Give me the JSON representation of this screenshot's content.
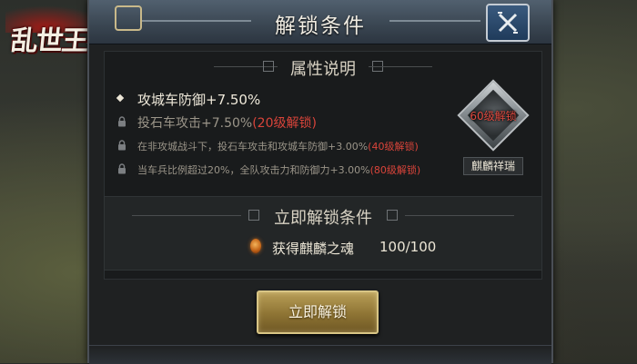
{
  "logo": {
    "text": "乱世王者"
  },
  "header": {
    "title": "解锁条件"
  },
  "attributes": {
    "section_title": "属性说明",
    "rows": [
      {
        "text": "攻城车防御+7.50%",
        "locked": false,
        "lock_note": ""
      },
      {
        "text": "投石车攻击+7.50%",
        "locked": true,
        "lock_note": "(20级解锁)"
      },
      {
        "text": "在非攻城战斗下，投石车攻击和攻城车防御+3.00%",
        "locked": true,
        "lock_note": "(40级解锁)"
      },
      {
        "text": "当车兵比例超过20%，全队攻击力和防御力+3.00%",
        "locked": true,
        "lock_note": "(80级解锁)"
      }
    ]
  },
  "badge": {
    "level_text": "60级解锁",
    "name": "麒麟祥瑞"
  },
  "unlock": {
    "section_title": "立即解锁条件",
    "item_name": "获得麒麟之魂",
    "item_count": "100/100",
    "button_label": "立即解锁"
  },
  "colors": {
    "accent_red": "#d9443a",
    "button_gold": "#b89e57",
    "header_blue": "#3b4753"
  },
  "icons": {
    "close": "close-x-icon",
    "bullet": "diamond-bullet-icon",
    "lock": "lock-icon",
    "item": "qilin-soul-icon"
  }
}
